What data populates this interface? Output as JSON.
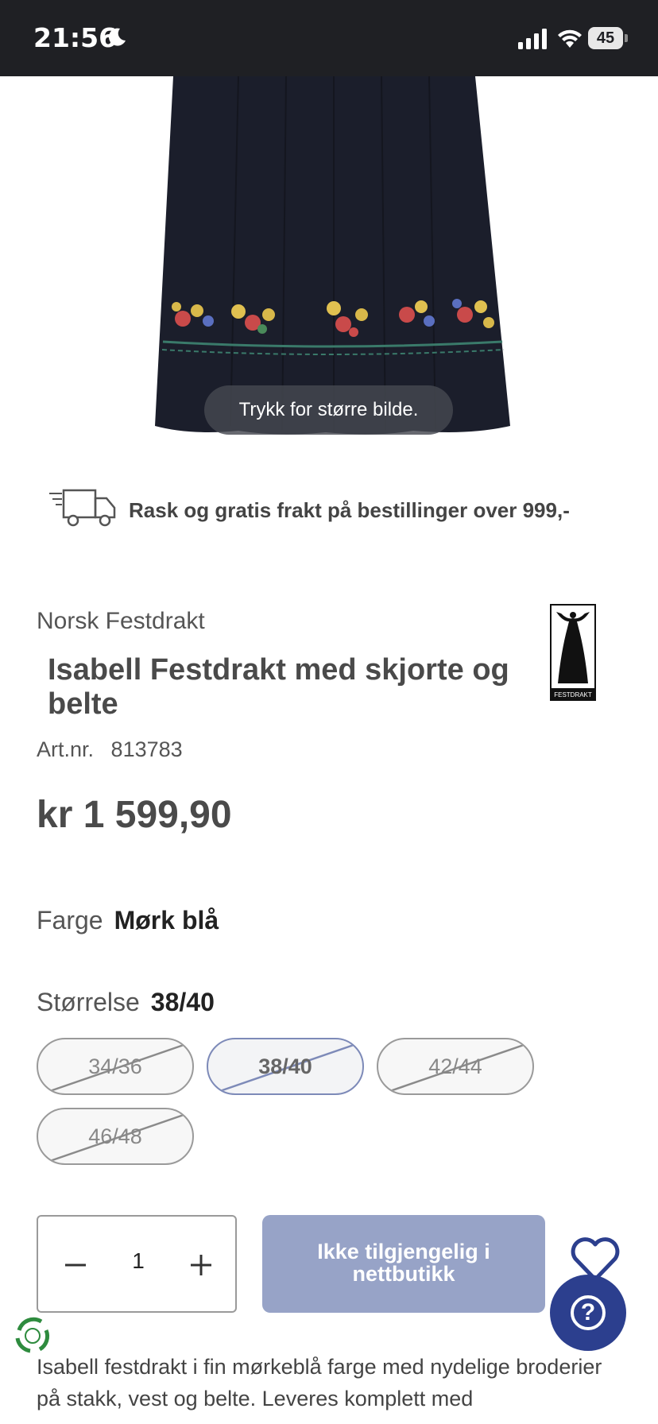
{
  "status_bar": {
    "time": "21:56",
    "battery_level": "45",
    "icons": [
      "moon-icon",
      "signal-icon",
      "wifi-icon",
      "battery-icon"
    ]
  },
  "product_image": {
    "hint": "Trykk for større bilde."
  },
  "shipping": {
    "text": "Rask og gratis frakt på bestillinger over 999,-"
  },
  "product": {
    "brand": "Norsk Festdrakt",
    "title": "Isabell Festdrakt med skjorte og belte",
    "logo_text": "FESTDRAKT",
    "art_label": "Art.nr.",
    "art_number": "813783",
    "price": "kr 1 599,90"
  },
  "options": {
    "color_label": "Farge",
    "color_value": "Mørk blå",
    "size_label": "Størrelse",
    "size_value": "38/40",
    "sizes": [
      {
        "label": "34/36",
        "available": false,
        "selected": false
      },
      {
        "label": "38/40",
        "available": false,
        "selected": true
      },
      {
        "label": "42/44",
        "available": false,
        "selected": false
      },
      {
        "label": "46/48",
        "available": false,
        "selected": false
      }
    ]
  },
  "purchase": {
    "quantity": "1",
    "cta_line1": "Ikke tilgjengelig i",
    "cta_line2": "nettbutikk",
    "help_label": "?"
  },
  "description": {
    "text": "Isabell festdrakt i fin mørkeblå farge med nydelige broderier på stakk, vest og belte. Leveres komplett med"
  },
  "colors": {
    "status_bar": "#1f2024",
    "cta": "#97a3c7",
    "help_button": "#2c3f8e",
    "dress": "#1b1e2b"
  }
}
